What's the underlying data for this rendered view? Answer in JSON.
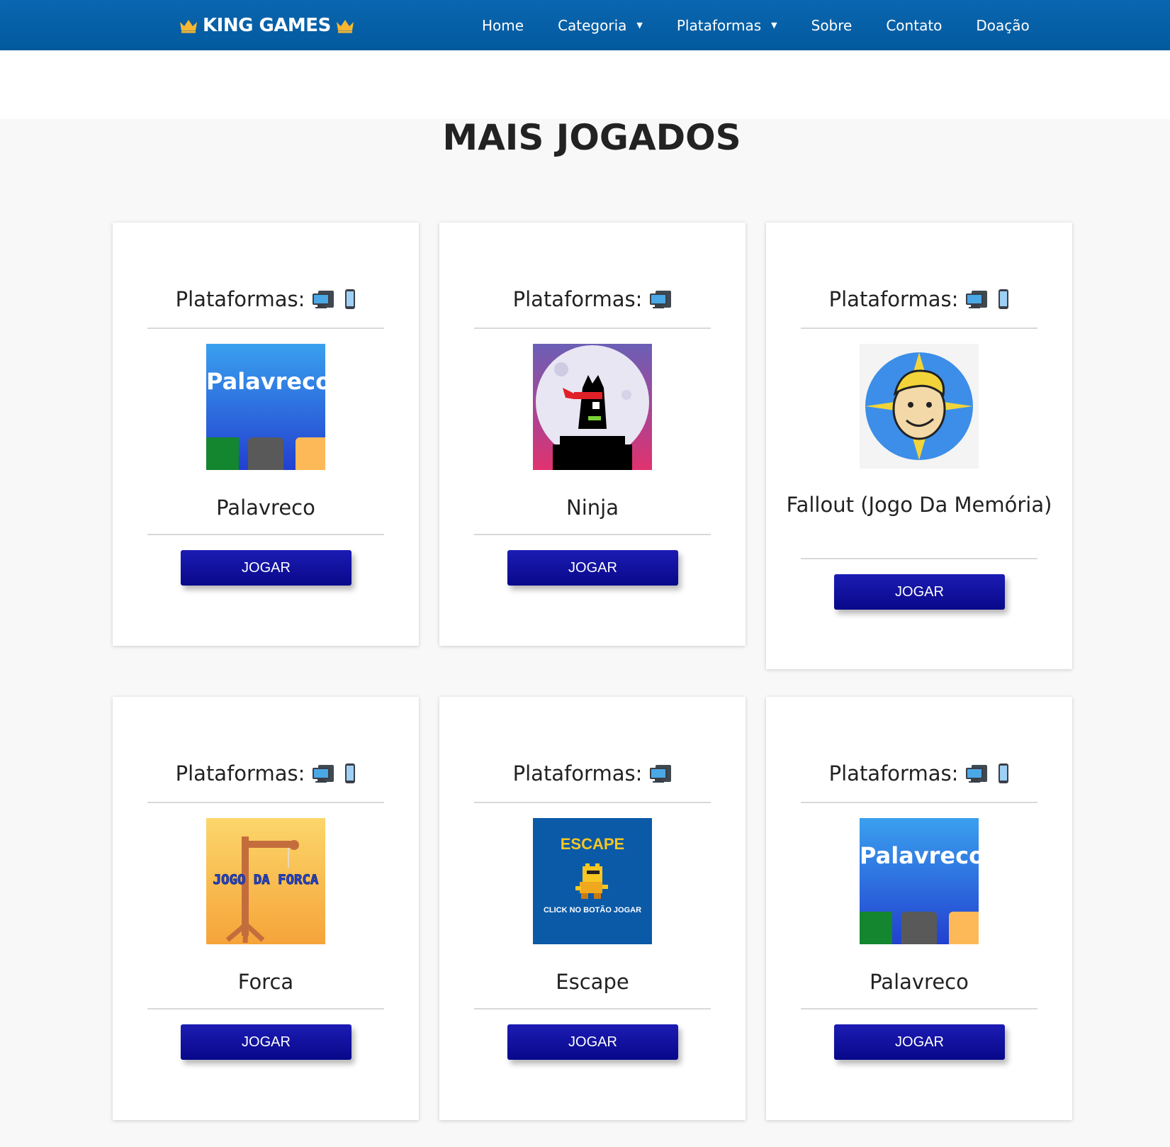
{
  "navbar": {
    "brand": "KING GAMES",
    "links": [
      {
        "label": "Home"
      },
      {
        "label": "Categoria"
      },
      {
        "label": "Plataformas"
      },
      {
        "label": "Sobre"
      },
      {
        "label": "Contato"
      },
      {
        "label": "Doação"
      }
    ],
    "bg_color": "#035a9e"
  },
  "section": {
    "title": "MAIS JOGADOS"
  },
  "platforms_label": "Plataformas:",
  "play_label": "JOGAR",
  "games": [
    {
      "name": "Palavreco",
      "platforms": [
        "desktop-icon",
        "mobile-icon"
      ],
      "thumb_text": "Palavreco"
    },
    {
      "name": "Ninja",
      "platforms": [
        "desktop-icon"
      ]
    },
    {
      "name": "Fallout (Jogo Da Memória)",
      "platforms": [
        "desktop-icon",
        "mobile-icon"
      ]
    },
    {
      "name": "Forca",
      "platforms": [
        "desktop-icon",
        "mobile-icon"
      ],
      "thumb_text": "JOGO DA FORCA"
    },
    {
      "name": "Escape",
      "platforms": [
        "desktop-icon"
      ],
      "thumb_text": "ESCAPE",
      "thumb_subtext": "CLICK NO BOTÃO JOGAR"
    },
    {
      "name": "Palavreco",
      "platforms": [
        "desktop-icon",
        "mobile-icon"
      ],
      "thumb_text": "Palavreco"
    }
  ],
  "colors": {
    "button": "#0e0e9e",
    "accent_crown": "#f7b733"
  }
}
